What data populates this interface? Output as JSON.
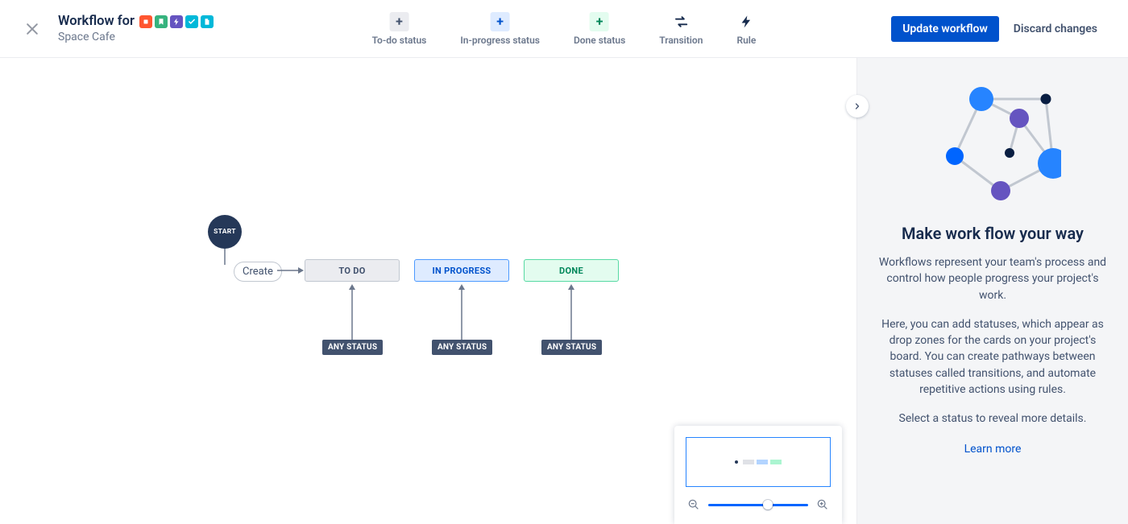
{
  "header": {
    "title_prefix": "Workflow for",
    "subtitle": "Space Cafe",
    "badges": [
      {
        "color": "#FF5630",
        "icon": "square"
      },
      {
        "color": "#36B37E",
        "icon": "bookmark"
      },
      {
        "color": "#6554C0",
        "icon": "bolt"
      },
      {
        "color": "#00B8D9",
        "icon": "check"
      },
      {
        "color": "#00B8D9",
        "icon": "page"
      }
    ]
  },
  "toolbar": {
    "items": [
      {
        "label": "To-do status",
        "icon_bg": "#EBECF0",
        "icon_color": "#42526E",
        "glyph": "+"
      },
      {
        "label": "In-progress status",
        "icon_bg": "#DEEBFF",
        "icon_color": "#0052CC",
        "glyph": "+"
      },
      {
        "label": "Done status",
        "icon_bg": "#E3FCEF",
        "icon_color": "#00875A",
        "glyph": "+"
      },
      {
        "label": "Transition",
        "icon_bg": "transparent",
        "icon_color": "#172B4D",
        "glyph": "transition"
      },
      {
        "label": "Rule",
        "icon_bg": "transparent",
        "icon_color": "#172B4D",
        "glyph": "bolt"
      }
    ]
  },
  "actions": {
    "primary": "Update workflow",
    "secondary": "Discard changes"
  },
  "workflow": {
    "start_label": "START",
    "create_label": "Create",
    "statuses": [
      {
        "label": "TO DO",
        "kind": "todo"
      },
      {
        "label": "IN PROGRESS",
        "kind": "inprogress"
      },
      {
        "label": "DONE",
        "kind": "done"
      }
    ],
    "any_status_label": "ANY STATUS"
  },
  "panel": {
    "title": "Make work flow your way",
    "p1": "Workflows represent your team's process and control how people progress your project's work.",
    "p2": "Here, you can add statuses, which appear as drop zones for the cards on your project's board. You can create pathways between statuses called transitions, and automate repetitive actions using rules.",
    "p3": "Select a status to reveal more details.",
    "link": "Learn more"
  }
}
